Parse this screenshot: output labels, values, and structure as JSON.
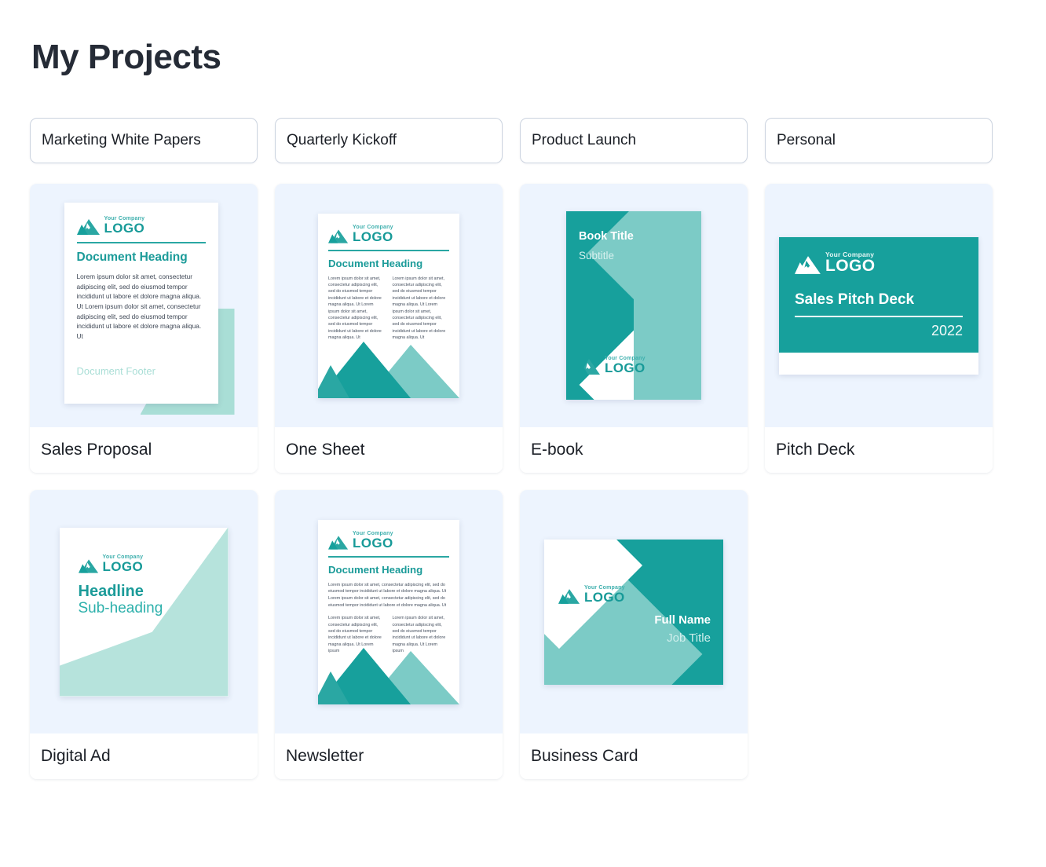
{
  "page": {
    "title": "My Projects"
  },
  "tabs": [
    {
      "label": "Marketing White Papers"
    },
    {
      "label": "Quarterly Kickoff"
    },
    {
      "label": "Product Launch"
    },
    {
      "label": "Personal"
    }
  ],
  "cards": [
    {
      "label": "Sales Proposal"
    },
    {
      "label": "One Sheet"
    },
    {
      "label": "E-book"
    },
    {
      "label": "Pitch Deck"
    },
    {
      "label": "Digital Ad"
    },
    {
      "label": "Newsletter"
    },
    {
      "label": "Business Card"
    }
  ],
  "logo": {
    "tagline": "Your Company",
    "word": "LOGO"
  },
  "sales_proposal": {
    "heading": "Document Heading",
    "body": "Lorem ipsum dolor sit amet, consectetur adipiscing elit, sed do eiusmod tempor incididunt ut labore et dolore magna aliqua. Ut Lorem ipsum dolor sit amet, consectetur adipiscing elit, sed do eiusmod tempor incididunt ut labore et dolore magna aliqua. Ut",
    "footer": "Document Footer"
  },
  "one_sheet": {
    "heading": "Document Heading",
    "col1": "Lorem ipsum dolor sit amet, consectetur adipiscing elit, sed do eiusmod tempor incididunt ut labore et dolore magna aliqua. Ut Lorem ipsum dolor sit amet, consectetur adipiscing elit, sed do eiusmod tempor incididunt ut labore et dolore magna aliqua. Ut",
    "col2": "Lorem ipsum dolor sit amet, consectetur adipiscing elit, sed do eiusmod tempor incididunt ut labore et dolore magna aliqua. Ut Lorem ipsum dolor sit amet, consectetur adipiscing elit, sed do eiusmod tempor incididunt ut labore et dolore magna aliqua. Ut"
  },
  "ebook": {
    "title": "Book Title",
    "subtitle": "Subtitle"
  },
  "pitch_deck": {
    "title": "Sales Pitch Deck",
    "year": "2022"
  },
  "digital_ad": {
    "headline": "Headline",
    "subheading": "Sub-heading"
  },
  "newsletter": {
    "heading": "Document Heading",
    "intro": "Lorem ipsum dolor sit amet, consectetur adipiscing elit, sed do eiusmod tempor incididunt ut labore et dolore magna aliqua. Ut Lorem ipsum dolor sit amet, consectetur adipiscing elit, sed do eiusmod tempor incididunt ut labore et dolore magna aliqua. Ut",
    "col1": "Lorem ipsum dolor sit amet, consectetur adipiscing elit, sed do eiusmod tempor incididunt ut labore et dolore magna aliqua. Ut Lorem ipsum",
    "col2": "Lorem ipsum dolor sit amet, consectetur adipiscing elit, sed do eiusmod tempor incididunt ut labore et dolore magna aliqua. Ut Lorem ipsum"
  },
  "business_card": {
    "name": "Full Name",
    "job": "Job Title"
  },
  "colors": {
    "teal": "#17a09c",
    "teal_light": "#7ccbc6",
    "mint": "#a9ded6",
    "thumb_bg": "#edf4fe",
    "title": "#252b36"
  }
}
